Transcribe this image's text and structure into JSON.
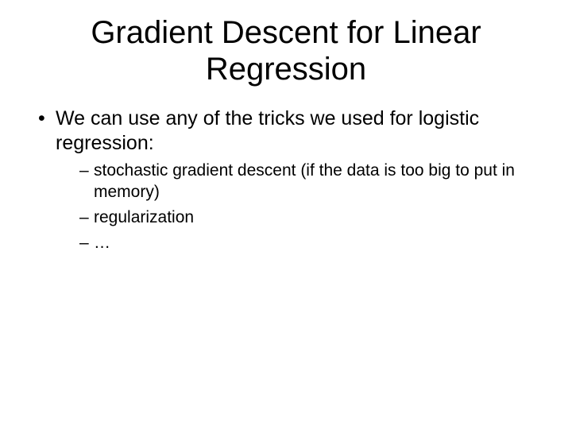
{
  "title": "Gradient Descent for Linear Regression",
  "bullet": {
    "text": "We can use any of the tricks we used for logistic regression:",
    "sub": [
      "stochastic gradient descent (if the data is too big to put in memory)",
      "regularization",
      "…"
    ]
  }
}
